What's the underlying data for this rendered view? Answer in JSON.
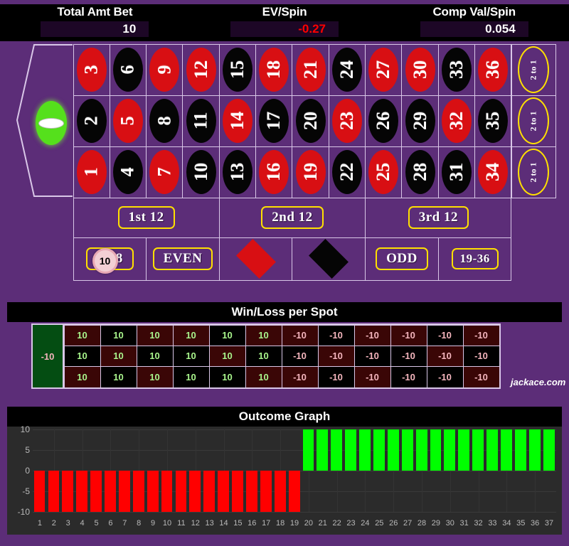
{
  "stats": [
    {
      "label": "Total Amt Bet",
      "value": "10",
      "negative": false
    },
    {
      "label": "EV/Spin",
      "value": "-0.27",
      "negative": true
    },
    {
      "label": "Comp Val/Spin",
      "value": "0.054",
      "negative": false
    }
  ],
  "table": {
    "zero_label": "0",
    "numbers": [
      {
        "n": "3",
        "c": "red"
      },
      {
        "n": "6",
        "c": "black"
      },
      {
        "n": "9",
        "c": "red"
      },
      {
        "n": "12",
        "c": "red"
      },
      {
        "n": "15",
        "c": "black"
      },
      {
        "n": "18",
        "c": "red"
      },
      {
        "n": "21",
        "c": "red"
      },
      {
        "n": "24",
        "c": "black"
      },
      {
        "n": "27",
        "c": "red"
      },
      {
        "n": "30",
        "c": "red"
      },
      {
        "n": "33",
        "c": "black"
      },
      {
        "n": "36",
        "c": "red"
      },
      {
        "n": "2",
        "c": "black"
      },
      {
        "n": "5",
        "c": "red"
      },
      {
        "n": "8",
        "c": "black"
      },
      {
        "n": "11",
        "c": "black"
      },
      {
        "n": "14",
        "c": "red"
      },
      {
        "n": "17",
        "c": "black"
      },
      {
        "n": "20",
        "c": "black"
      },
      {
        "n": "23",
        "c": "red"
      },
      {
        "n": "26",
        "c": "black"
      },
      {
        "n": "29",
        "c": "black"
      },
      {
        "n": "32",
        "c": "red"
      },
      {
        "n": "35",
        "c": "black"
      },
      {
        "n": "1",
        "c": "red"
      },
      {
        "n": "4",
        "c": "black"
      },
      {
        "n": "7",
        "c": "red"
      },
      {
        "n": "10",
        "c": "black"
      },
      {
        "n": "13",
        "c": "black"
      },
      {
        "n": "16",
        "c": "red"
      },
      {
        "n": "19",
        "c": "red"
      },
      {
        "n": "22",
        "c": "black"
      },
      {
        "n": "25",
        "c": "red"
      },
      {
        "n": "28",
        "c": "black"
      },
      {
        "n": "31",
        "c": "black"
      },
      {
        "n": "34",
        "c": "red"
      }
    ],
    "column_bets": [
      "2 to 1",
      "2 to 1",
      "2 to 1"
    ],
    "dozens": [
      "1st 12",
      "2nd 12",
      "3rd 12"
    ],
    "outside": [
      {
        "label": "1-18",
        "kind": "pill",
        "chip": "10"
      },
      {
        "label": "EVEN",
        "kind": "pill"
      },
      {
        "label": "RED",
        "kind": "diamond-red"
      },
      {
        "label": "BLACK",
        "kind": "diamond-black"
      },
      {
        "label": "ODD",
        "kind": "pill"
      },
      {
        "label": "19-36",
        "kind": "pill"
      }
    ],
    "accent_yellow": "#ffe000",
    "felt_purple": "#5c2d78",
    "red": "#d80f13",
    "black": "#050505",
    "green": "#55e01c"
  },
  "winloss": {
    "title": "Win/Loss per Spot",
    "zero_value": "-10",
    "rows": [
      [
        {
          "v": "10",
          "c": "red"
        },
        {
          "v": "10",
          "c": "black"
        },
        {
          "v": "10",
          "c": "red"
        },
        {
          "v": "10",
          "c": "red"
        },
        {
          "v": "10",
          "c": "black"
        },
        {
          "v": "10",
          "c": "red"
        },
        {
          "v": "-10",
          "c": "red"
        },
        {
          "v": "-10",
          "c": "black"
        },
        {
          "v": "-10",
          "c": "red"
        },
        {
          "v": "-10",
          "c": "red"
        },
        {
          "v": "-10",
          "c": "black"
        },
        {
          "v": "-10",
          "c": "red"
        }
      ],
      [
        {
          "v": "10",
          "c": "black"
        },
        {
          "v": "10",
          "c": "red"
        },
        {
          "v": "10",
          "c": "black"
        },
        {
          "v": "10",
          "c": "black"
        },
        {
          "v": "10",
          "c": "red"
        },
        {
          "v": "10",
          "c": "black"
        },
        {
          "v": "-10",
          "c": "black"
        },
        {
          "v": "-10",
          "c": "red"
        },
        {
          "v": "-10",
          "c": "black"
        },
        {
          "v": "-10",
          "c": "black"
        },
        {
          "v": "-10",
          "c": "red"
        },
        {
          "v": "-10",
          "c": "black"
        }
      ],
      [
        {
          "v": "10",
          "c": "red"
        },
        {
          "v": "10",
          "c": "black"
        },
        {
          "v": "10",
          "c": "red"
        },
        {
          "v": "10",
          "c": "black"
        },
        {
          "v": "10",
          "c": "black"
        },
        {
          "v": "10",
          "c": "red"
        },
        {
          "v": "-10",
          "c": "red"
        },
        {
          "v": "-10",
          "c": "black"
        },
        {
          "v": "-10",
          "c": "red"
        },
        {
          "v": "-10",
          "c": "black"
        },
        {
          "v": "-10",
          "c": "black"
        },
        {
          "v": "-10",
          "c": "red"
        }
      ]
    ],
    "brand": "jackace.com",
    "pos_color": "#a9f58c",
    "neg_color": "#f4b5bd"
  },
  "chart_data": {
    "type": "bar",
    "title": "Outcome Graph",
    "xlabel": "",
    "ylabel": "",
    "ylim": [
      -10,
      10
    ],
    "yticks": [
      10,
      5,
      0,
      -5,
      -10
    ],
    "grid": true,
    "legend": "none",
    "categories": [
      "1",
      "2",
      "3",
      "4",
      "5",
      "6",
      "7",
      "8",
      "9",
      "10",
      "11",
      "12",
      "13",
      "14",
      "15",
      "16",
      "17",
      "18",
      "19",
      "20",
      "21",
      "22",
      "23",
      "24",
      "25",
      "26",
      "27",
      "28",
      "29",
      "30",
      "31",
      "32",
      "33",
      "34",
      "35",
      "36",
      "37"
    ],
    "values": [
      -10,
      -10,
      -10,
      -10,
      -10,
      -10,
      -10,
      -10,
      -10,
      -10,
      -10,
      -10,
      -10,
      -10,
      -10,
      -10,
      -10,
      -10,
      -10,
      10,
      10,
      10,
      10,
      10,
      10,
      10,
      10,
      10,
      10,
      10,
      10,
      10,
      10,
      10,
      10,
      10,
      10
    ],
    "positive_color": "#00ff00",
    "negative_color": "#ff0000",
    "plot_bg": "#2b2b2b"
  }
}
